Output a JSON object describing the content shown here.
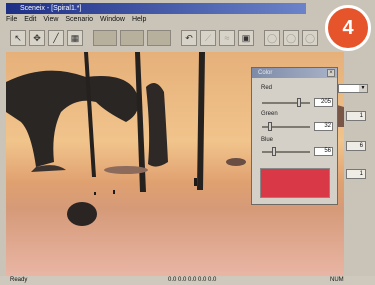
{
  "window": {
    "title": "Sceneix - [Spiral1.*]"
  },
  "menu": [
    "File",
    "Edit",
    "View",
    "Scenario",
    "Window",
    "Help"
  ],
  "toolbar": [
    {
      "name": "select-tool",
      "glyph": "↖",
      "kind": "normal"
    },
    {
      "name": "move-tool",
      "glyph": "✥",
      "kind": "normal"
    },
    {
      "name": "draw-tool",
      "glyph": "╱",
      "kind": "normal"
    },
    {
      "name": "layer-tool",
      "glyph": "▦",
      "kind": "normal"
    },
    {
      "name": "terrain-tool",
      "glyph": "",
      "kind": "wide"
    },
    {
      "name": "texture-tool",
      "glyph": "",
      "kind": "wide"
    },
    {
      "name": "object-tool",
      "glyph": "",
      "kind": "wide"
    },
    {
      "name": "path-tool",
      "glyph": "↶",
      "kind": "normal"
    },
    {
      "name": "link-tool",
      "glyph": "⟋",
      "kind": "dim"
    },
    {
      "name": "chain-tool",
      "glyph": "≈",
      "kind": "dim"
    },
    {
      "name": "camera-tool",
      "glyph": "▣",
      "kind": "normal"
    },
    {
      "name": "undo-tool",
      "glyph": "◯",
      "kind": "dim"
    },
    {
      "name": "redo-tool",
      "glyph": "◯",
      "kind": "dim"
    },
    {
      "name": "loop-tool",
      "glyph": "◯",
      "kind": "dim"
    }
  ],
  "color_dialog": {
    "title": "Color",
    "close_glyph": "×",
    "channels": [
      {
        "label": "Red",
        "value": "205",
        "level": 0.8
      },
      {
        "label": "Green",
        "value": "32",
        "level": 0.13
      },
      {
        "label": "Blue",
        "value": "56",
        "level": 0.22
      }
    ],
    "swatch_color": "#d93946"
  },
  "side_fields": [
    "1",
    "6",
    "1"
  ],
  "status": {
    "left": "Ready",
    "coords": "0.0 0.0 0.0 0.0 0.0",
    "mode": "NUM"
  },
  "badge": {
    "number": "4",
    "color": "#e6542c"
  },
  "colors": {
    "title_start": "#1e2f86",
    "title_end": "#6b83c8",
    "sky": "#f1c48c"
  }
}
